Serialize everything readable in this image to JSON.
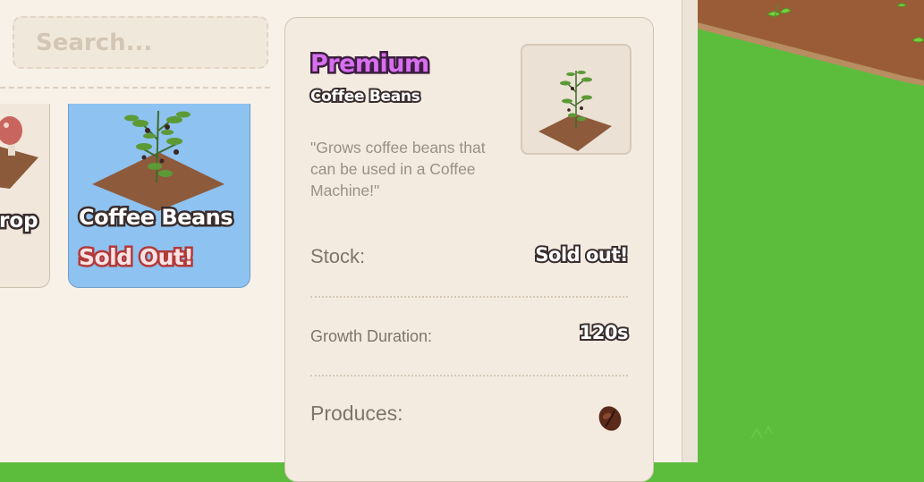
{
  "search": {
    "placeholder": "Search..."
  },
  "shop_items": [
    {
      "name": "Crop",
      "visible_text": "rop"
    },
    {
      "name": "Coffee Beans",
      "status": "Sold Out!"
    }
  ],
  "detail": {
    "rarity": "Premium",
    "item_name": "Coffee Beans",
    "description": "\"Grows coffee beans that can be used in a Coffee Machine!\"",
    "stock_label": "Stock:",
    "stock_value": "Sold out!",
    "growth_label": "Growth Duration:",
    "growth_value": "120s",
    "produces_label": "Produces:",
    "produces_icon": "coffee-bean-icon"
  },
  "colors": {
    "rarity": "#d86ef0",
    "selected_card": "#8ec2f0",
    "sold_out": "#b23a3a",
    "grass": "#5cbd3c",
    "soil": "#9a5c36"
  }
}
